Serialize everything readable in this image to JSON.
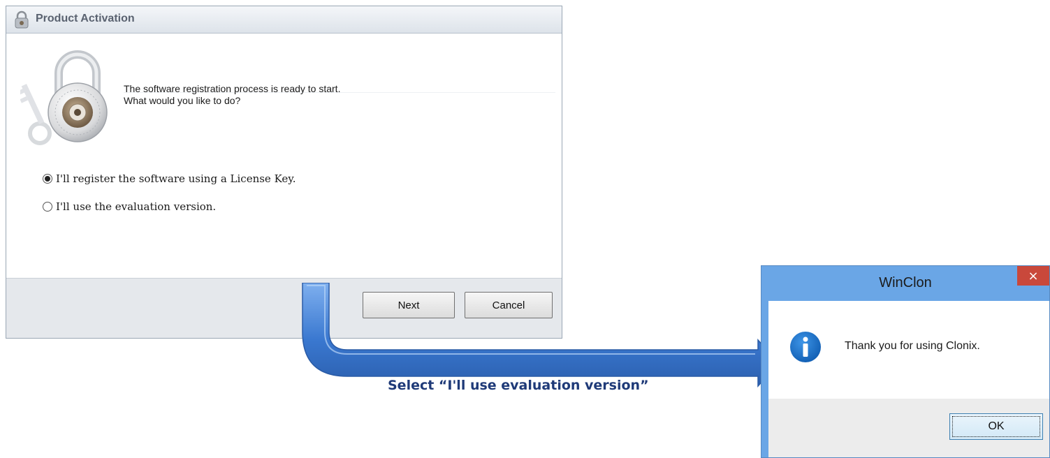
{
  "activation_window": {
    "title": "Product Activation",
    "message_line1": "The software registration process is ready to start.",
    "message_line2": "What would you like to do?",
    "options": [
      {
        "label": "I'll register the software using a License Key.",
        "selected": true
      },
      {
        "label": "I'll use the evaluation version.",
        "selected": false
      }
    ],
    "next_label": "Next",
    "cancel_label": "Cancel"
  },
  "annotation": {
    "caption": "Select “I'll use evaluation version”",
    "arrow_color": "#3a78d0"
  },
  "winclon_dialog": {
    "title": "WinClon",
    "close_glyph": "×",
    "message": "Thank you for using Clonix.",
    "ok_label": "OK",
    "icon": "info-icon"
  },
  "colors": {
    "dialog_frame": "#6aa6e6",
    "close_button": "#c9483b",
    "info_icon": "#1f73c8"
  }
}
